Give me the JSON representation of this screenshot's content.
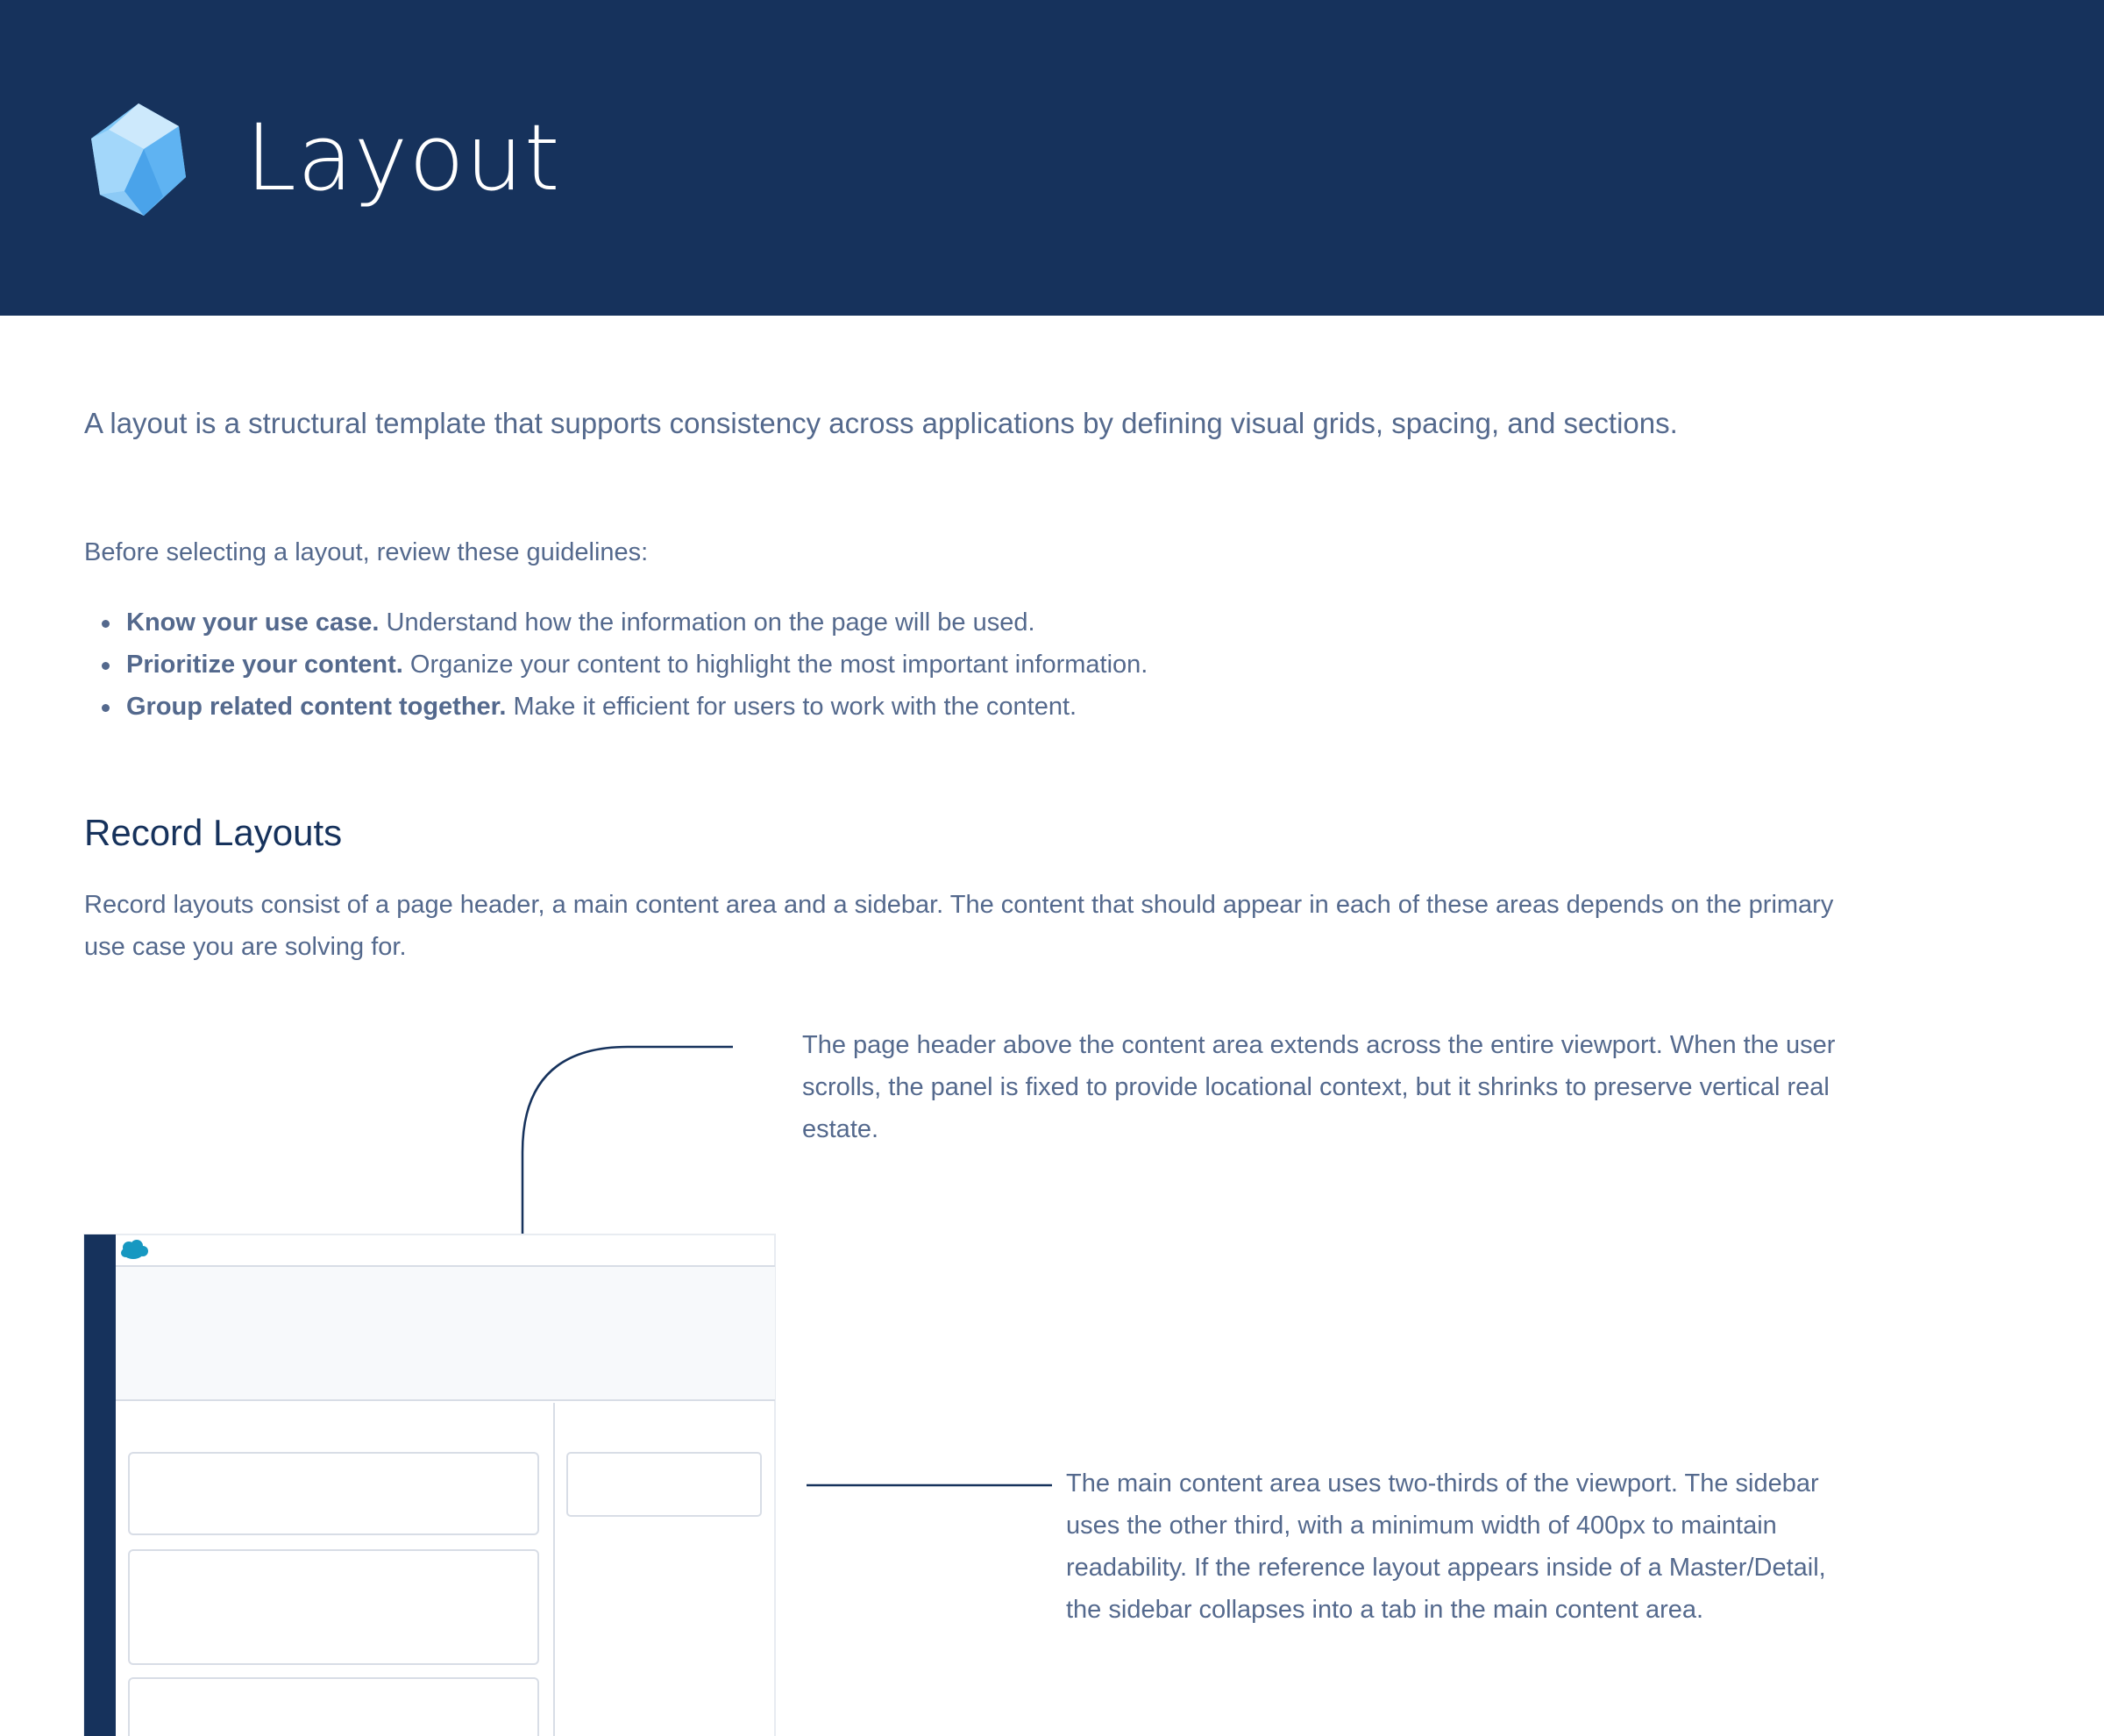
{
  "header": {
    "title": "Layout",
    "logo_icon": "crystal-icon",
    "background": "#16325c"
  },
  "intro": "A layout is a structural template that supports consistency across applications by defining visual grids, spacing, and sections.",
  "guidelines": {
    "lead": "Before selecting a layout, review these guidelines:",
    "items": [
      {
        "term": "Know your use case.",
        "text": " Understand how the information on the page will be used."
      },
      {
        "term": "Prioritize your content.",
        "text": " Organize your content to highlight the most important information."
      },
      {
        "term": "Group related content together.",
        "text": " Make it efficient for users to work with the content."
      }
    ]
  },
  "record_layouts": {
    "title": "Record Layouts",
    "description": "Record layouts consist of a page header, a main content area and a sidebar. The content that should appear in each of these areas depends on the primary use case you are solving for.",
    "annotations": {
      "page_header": "The page header above the content area extends across the entire viewport. When the user scrolls, the panel is fixed to provide locational context, but it shrinks to preserve vertical real estate.",
      "main_content": "The main content area uses two-thirds of the viewport. The sidebar uses the other third, with a minimum width of 400px to maintain readability. If the reference layout appears inside of a Master/Detail, the sidebar collapses into a tab in the main content area."
    },
    "diagram": {
      "cloud_icon": "salesforce-cloud-icon",
      "nav_color": "#16325c",
      "header_bg": "#f7f9fb",
      "border_color": "#d8dde6",
      "cloud_color": "#1798c1"
    }
  }
}
